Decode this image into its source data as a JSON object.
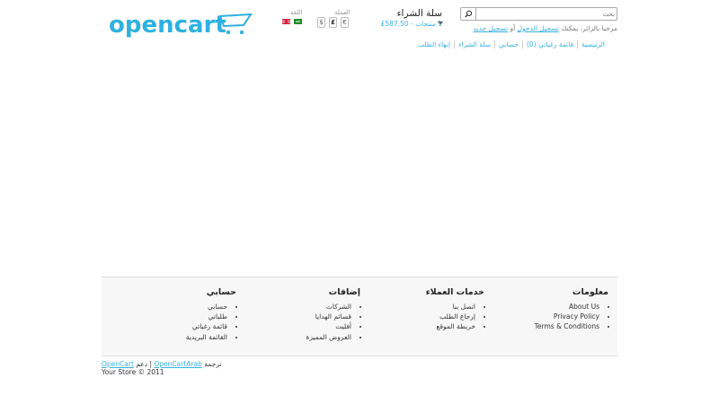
{
  "header": {
    "logo_text": "opencart",
    "search": {
      "placeholder": "بحث"
    },
    "welcome": {
      "prefix": "مرحبا بالزائر، يمكنك",
      "login": "تسجيل الدخول",
      "or": "أو",
      "register": "تسجيل جديد"
    },
    "cart": {
      "title": "سلة الشراء",
      "total": "1 منتجات - 587.50£"
    },
    "currency": {
      "label": "العملة",
      "options": [
        "€",
        "£",
        "$"
      ]
    },
    "language": {
      "label": "اللغة",
      "options": [
        "Arabic",
        "English"
      ]
    },
    "nav": [
      "الرئيسية",
      "قائمة رغباتي (0)",
      "حسابي",
      "سلة الشراء",
      "إنهاء الطلب"
    ]
  },
  "footer": {
    "columns": [
      {
        "title": "معلومات",
        "items": [
          "About Us",
          "Privacy Policy",
          "Terms & Conditions"
        ]
      },
      {
        "title": "خدمات العملاء",
        "items": [
          "اتصل بنا",
          "إرجاع الطلب",
          "خريطة الموقع"
        ]
      },
      {
        "title": "إضافات",
        "items": [
          "الشركات",
          "قسائم الهدايا",
          "أفليت",
          "العروض المميزة"
        ]
      },
      {
        "title": "حسابي",
        "items": [
          "حسابي",
          "طلباتي",
          "قائمة رغباتي",
          "القائمة البريدية"
        ]
      }
    ],
    "powered": {
      "opencart": "OpenCart",
      "support": "دعم",
      "separator": "|",
      "arab": "OpenCartArab",
      "translation": "ترجمة"
    },
    "copyright": "Your Store © 2011"
  },
  "colors": {
    "accent": "#38b0e3",
    "logo": "#2fb1df"
  }
}
